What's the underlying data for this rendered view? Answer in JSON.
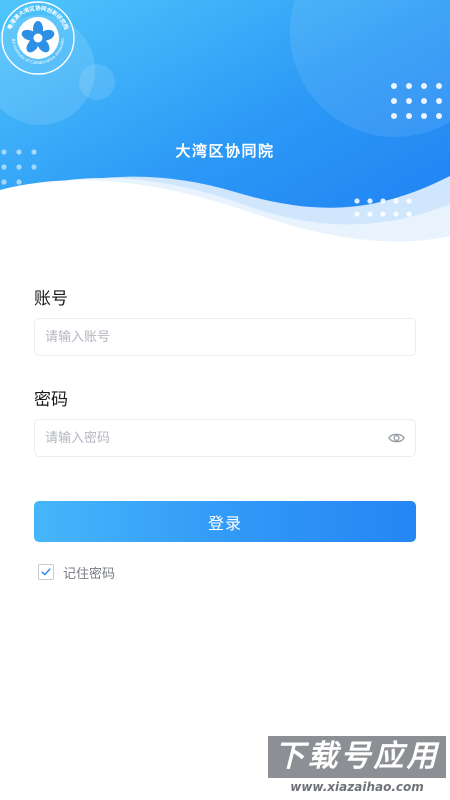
{
  "header": {
    "brand_title": "大湾区协同院",
    "logo_ring_text": "粤港澳大湾区协同创新研究院",
    "logo_ring_text_en": "GBA Institute of Collaborative Innovation",
    "colors": {
      "gradient_start": "#4fc6fb",
      "gradient_end": "#1f7ef2",
      "wave_light": "#cfe6fd"
    }
  },
  "form": {
    "account_label": "账号",
    "account_placeholder": "请输入账号",
    "account_value": "",
    "password_label": "密码",
    "password_placeholder": "请输入密码",
    "password_value": "",
    "password_toggle_icon": "eye-icon",
    "login_label": "登录",
    "remember_label": "记住密码",
    "remember_checked": true
  },
  "watermark": {
    "title": "下载号应用",
    "url": "www.xiazaihao.com"
  }
}
